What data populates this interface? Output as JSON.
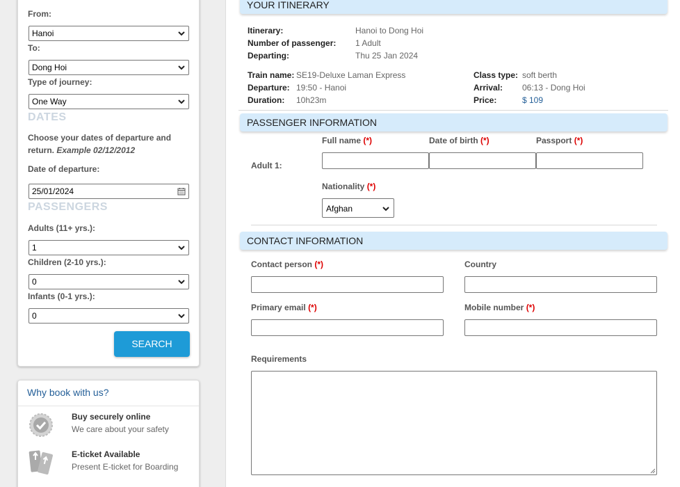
{
  "search": {
    "from_label": "From:",
    "from_value": "Hanoi",
    "to_label": "To:",
    "to_value": "Dong Hoi",
    "journey_label": "Type of journey:",
    "journey_value": "One Way",
    "dates_heading": "DATES",
    "dates_help": "Choose your dates of departure and return.",
    "dates_example": "Example 02/12/2012",
    "departure_date_label": "Date of departure:",
    "departure_date_value": "25/01/2024",
    "passengers_heading": "PASSENGERS",
    "adults_label": "Adults (11+ yrs.):",
    "adults_value": "1",
    "children_label": "Children (2-10 yrs.):",
    "children_value": "0",
    "infants_label": "Infants (0-1 yrs.):",
    "infants_value": "0",
    "search_button": "SEARCH"
  },
  "why": {
    "title": "Why book with us?",
    "items": [
      {
        "icon": "checkmark-badge-icon",
        "title": "Buy securely online",
        "subtitle": "We care about your safety"
      },
      {
        "icon": "ticket-icon",
        "title": "E-ticket Available",
        "subtitle": "Present E-ticket for Boarding"
      }
    ]
  },
  "itinerary": {
    "header": "YOUR ITINERARY",
    "itinerary_label": "Itinerary:",
    "itinerary_value": "Hanoi to Dong Hoi",
    "passengers_label": "Number of passenger:",
    "passengers_value": "1 Adult",
    "departing_label": "Departing:",
    "departing_value": "Thu 25 Jan 2024",
    "train_label": "Train name:",
    "train_value": "SE19-Deluxe Laman Express",
    "departure_label": "Departure:",
    "departure_value": "19:50 - Hanoi",
    "duration_label": "Duration:",
    "duration_value": "10h23m",
    "class_label": "Class type:",
    "class_value": "soft berth",
    "arrival_label": "Arrival:",
    "arrival_value": "06:13 - Dong Hoi",
    "price_label": "Price:",
    "price_value": "$ 109"
  },
  "passenger": {
    "header": "PASSENGER INFORMATION",
    "adult_label": "Adult 1:",
    "full_name_label": "Full name",
    "dob_label": "Date of birth",
    "passport_label": "Passport",
    "nationality_label": "Nationality",
    "nationality_value": "Afghan",
    "required_mark": "(*)"
  },
  "contact": {
    "header": "CONTACT INFORMATION",
    "contact_person_label": "Contact person",
    "country_label": "Country",
    "email_label": "Primary email",
    "mobile_label": "Mobile number",
    "requirements_label": "Requirements",
    "required_mark": "(*)"
  },
  "colors": {
    "accent": "#1e9bd7",
    "section_header_bg": "#d6ebfb",
    "link": "#245f98",
    "required": "#dd0000"
  }
}
